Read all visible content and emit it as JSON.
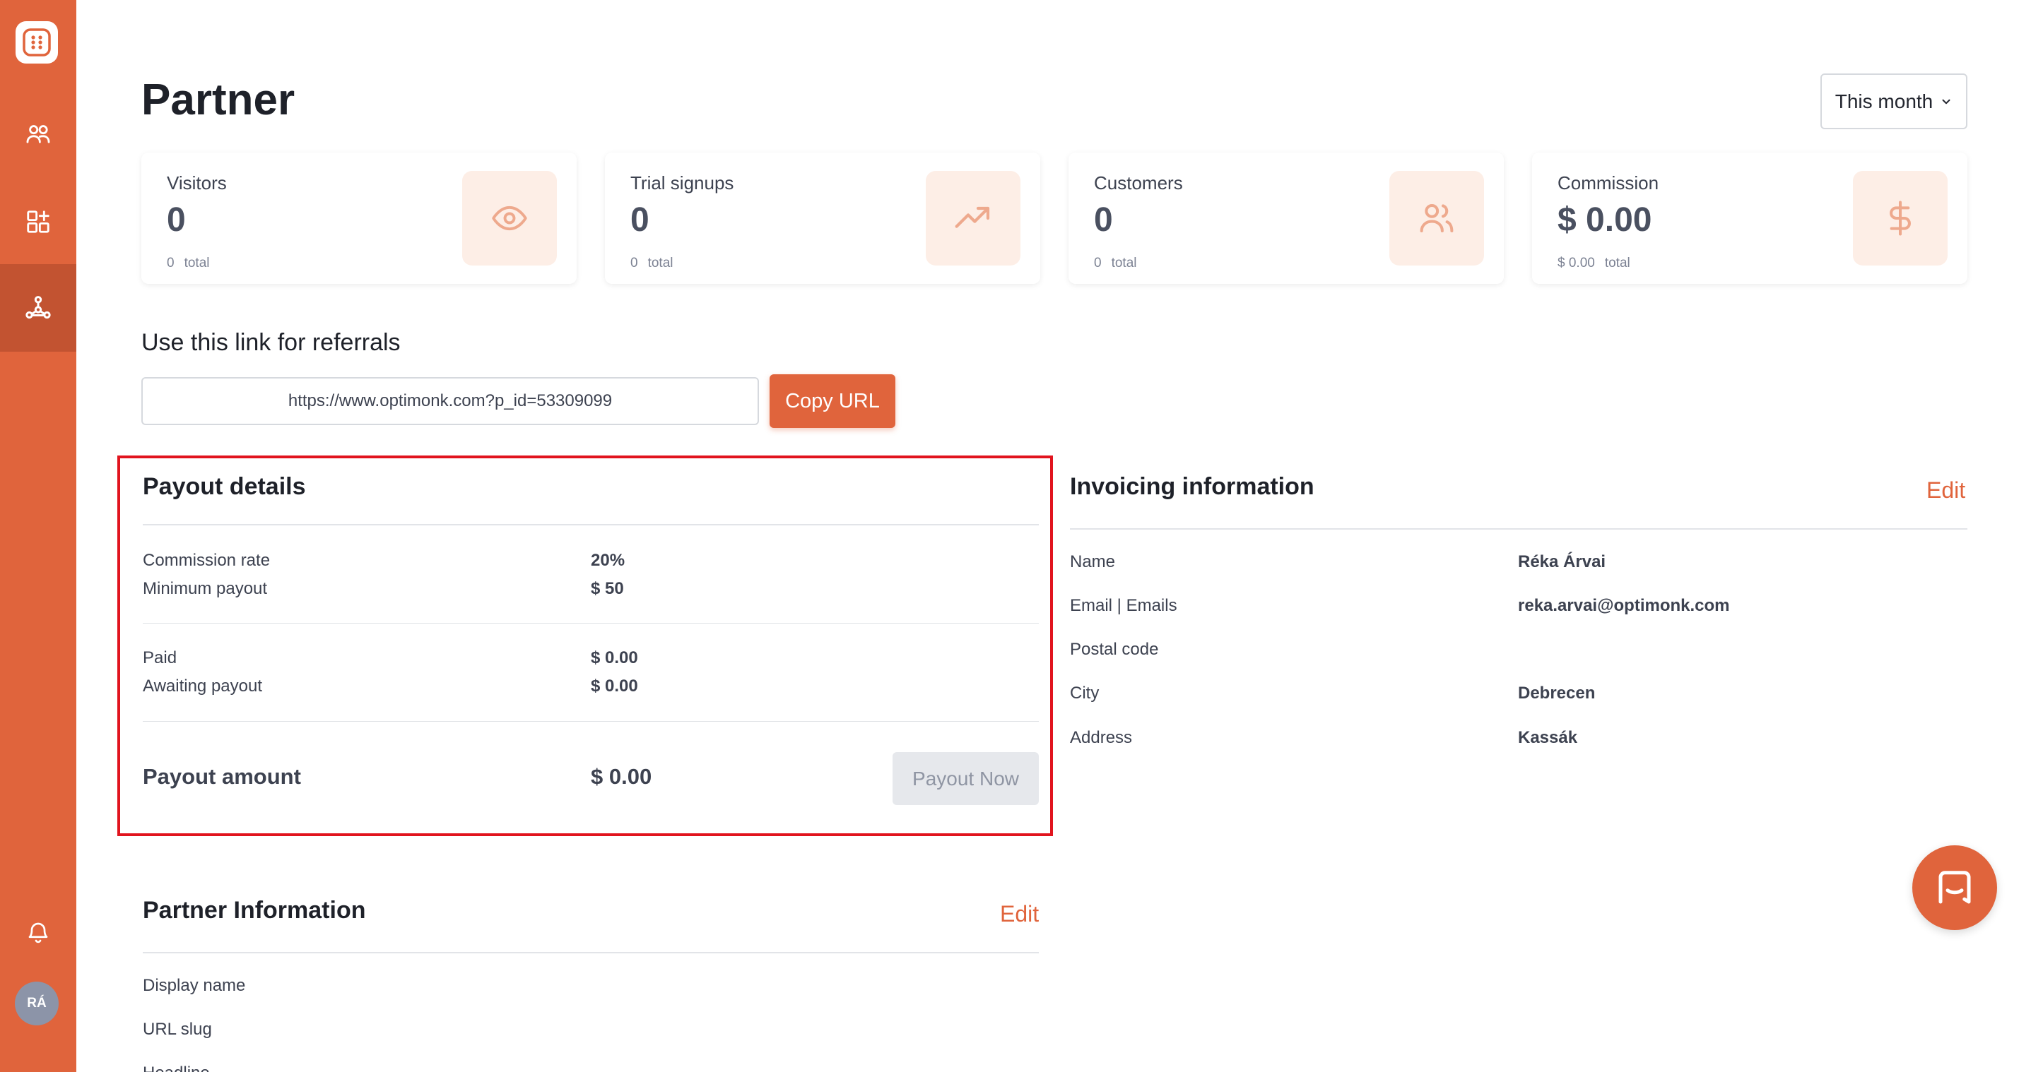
{
  "sidebar": {
    "logo_icon": "app-grid-logo-icon",
    "items": [
      {
        "name": "users-icon",
        "active": false
      },
      {
        "name": "add-widget-icon",
        "active": false
      },
      {
        "name": "partner-network-icon",
        "active": true
      }
    ],
    "notification_icon": "bell-icon",
    "avatar_initials": "RÁ"
  },
  "header": {
    "title": "Partner",
    "period": "This month"
  },
  "stats": [
    {
      "label": "Visitors",
      "value": "0",
      "total_value": "0",
      "total_label": "total",
      "icon": "eye-icon"
    },
    {
      "label": "Trial signups",
      "value": "0",
      "total_value": "0",
      "total_label": "total",
      "icon": "trending-up-icon"
    },
    {
      "label": "Customers",
      "value": "0",
      "total_value": "0",
      "total_label": "total",
      "icon": "users-icon"
    },
    {
      "label": "Commission",
      "value": "$ 0.00",
      "total_value": "$ 0.00",
      "total_label": "total",
      "icon": "dollar-icon"
    }
  ],
  "referral": {
    "heading": "Use this link for referrals",
    "url": "https://www.optimonk.com?p_id=53309099",
    "copy_label": "Copy URL"
  },
  "payout": {
    "title": "Payout details",
    "commission_rate_label": "Commission rate",
    "commission_rate_value": "20%",
    "minimum_payout_label": "Minimum payout",
    "minimum_payout_value": "$ 50",
    "paid_label": "Paid",
    "paid_value": "$ 0.00",
    "awaiting_label": "Awaiting payout",
    "awaiting_value": "$ 0.00",
    "amount_label": "Payout amount",
    "amount_value": "$ 0.00",
    "button_label": "Payout Now"
  },
  "invoicing": {
    "title": "Invoicing information",
    "edit_label": "Edit",
    "rows": [
      {
        "label": "Name",
        "value": "Réka Árvai"
      },
      {
        "label": "Email | Emails",
        "value": "reka.arvai@optimonk.com"
      },
      {
        "label": "Postal code",
        "value": ""
      },
      {
        "label": "City",
        "value": "Debrecen"
      },
      {
        "label": "Address",
        "value": "Kassák"
      }
    ]
  },
  "partner_info": {
    "title": "Partner Information",
    "edit_label": "Edit",
    "rows": [
      {
        "label": "Display name"
      },
      {
        "label": "URL slug"
      },
      {
        "label": "Headline"
      }
    ]
  },
  "chat": {
    "icon": "chat-icon"
  },
  "colors": {
    "accent": "#e0643c",
    "sidebar_active": "#c25331",
    "highlight": "#e1141e"
  }
}
